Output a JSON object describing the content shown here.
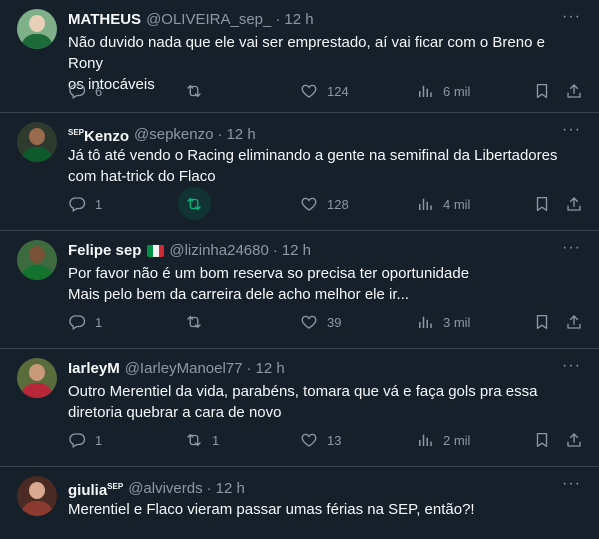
{
  "colors": {
    "background": "#15202b",
    "text": "#f7f9f9",
    "muted": "#8b98a5",
    "divider": "#38444d",
    "retweet_active": "#00ba7c"
  },
  "tweets": [
    {
      "name": "MATHEUS",
      "name_sup": "",
      "handle": "@OLIVEIRA_sep_",
      "separator": "·",
      "time": "12 h",
      "text_line1": "Não duvido nada que ele vai ser emprestado, aí vai ficar com o Breno e Rony",
      "text_line2": "os intocáveis",
      "replies": "6",
      "retweets": "",
      "likes": "124",
      "views": "6 mil",
      "more": "···"
    },
    {
      "name": "Kenzo",
      "name_sup": "SEP",
      "handle": "@sepkenzo",
      "separator": "·",
      "time": "12 h",
      "text_line1": "Já tô até vendo o Racing eliminando a gente na semifinal da Libertadores",
      "text_line2": "com hat-trick do Flaco",
      "replies": "1",
      "retweets": "",
      "likes": "128",
      "views": "4 mil",
      "more": "···"
    },
    {
      "name": "Felipe sep",
      "name_sup": "",
      "flag": "italy-flag",
      "handle": "@lizinha24680",
      "separator": "·",
      "time": "12 h",
      "text_line1": "Por favor não é um bom reserva so precisa ter oportunidade",
      "text_line2": "Mais pelo bem da carreira dele acho melhor ele ir...",
      "replies": "1",
      "retweets": "",
      "likes": "39",
      "views": "3 mil",
      "more": "···"
    },
    {
      "name": "IarleyM",
      "name_sup": "",
      "handle": "@IarleyManoel77",
      "separator": "·",
      "time": "12 h",
      "text_line1": "Outro Merentiel da vida, parabéns, tomara que vá e faça gols pra essa",
      "text_line2": "diretoria quebrar a cara de novo",
      "replies": "1",
      "retweets": "1",
      "likes": "13",
      "views": "2 mil",
      "more": "···"
    },
    {
      "name": "giulia",
      "name_sup": "SEP",
      "handle": "@alviverds",
      "separator": "·",
      "time": "12 h",
      "text_line1": "Merentiel e Flaco vieram passar umas férias na SEP, então?!",
      "text_line2": "",
      "more": "···"
    }
  ]
}
